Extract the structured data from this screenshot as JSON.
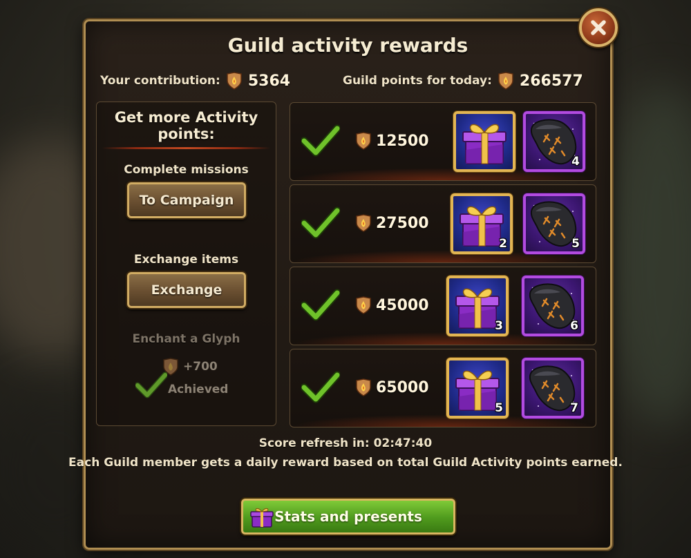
{
  "dialog": {
    "title": "Guild activity rewards"
  },
  "header": {
    "contribution_label": "Your contribution:",
    "contribution_value": "5364",
    "guild_points_label": "Guild points for today:",
    "guild_points_value": "266577"
  },
  "sidebar": {
    "heading_line1": "Get more Activity",
    "heading_line2": "points:",
    "missions_label": "Complete missions",
    "campaign_button": "To Campaign",
    "exchange_label": "Exchange items",
    "exchange_button": "Exchange",
    "glyph_label": "Enchant a Glyph",
    "glyph_bonus": "+700",
    "glyph_status": "Achieved"
  },
  "rewards": [
    {
      "points": "12500",
      "gift_qty": "",
      "glyph_qty": "4",
      "claimed": true
    },
    {
      "points": "27500",
      "gift_qty": "2",
      "glyph_qty": "5",
      "claimed": true
    },
    {
      "points": "45000",
      "gift_qty": "3",
      "glyph_qty": "6",
      "claimed": true
    },
    {
      "points": "65000",
      "gift_qty": "5",
      "glyph_qty": "7",
      "claimed": true
    }
  ],
  "footer": {
    "refresh_text": "Score refresh in: 02:47:40",
    "info_text": "Each Guild member gets a daily reward based on total Guild Activity points earned.",
    "stats_button": "Stats and presents"
  },
  "icons": {
    "close": "close-icon",
    "activity": "activity-shield-icon",
    "check": "checkmark-icon",
    "gift": "gift-box-icon",
    "glyph": "glyph-stone-icon"
  },
  "colors": {
    "accent_gold": "#d1ac63",
    "check_green": "#6fc22a",
    "button_green": "#4f9a1d",
    "glyph_purple": "#b24be0"
  }
}
